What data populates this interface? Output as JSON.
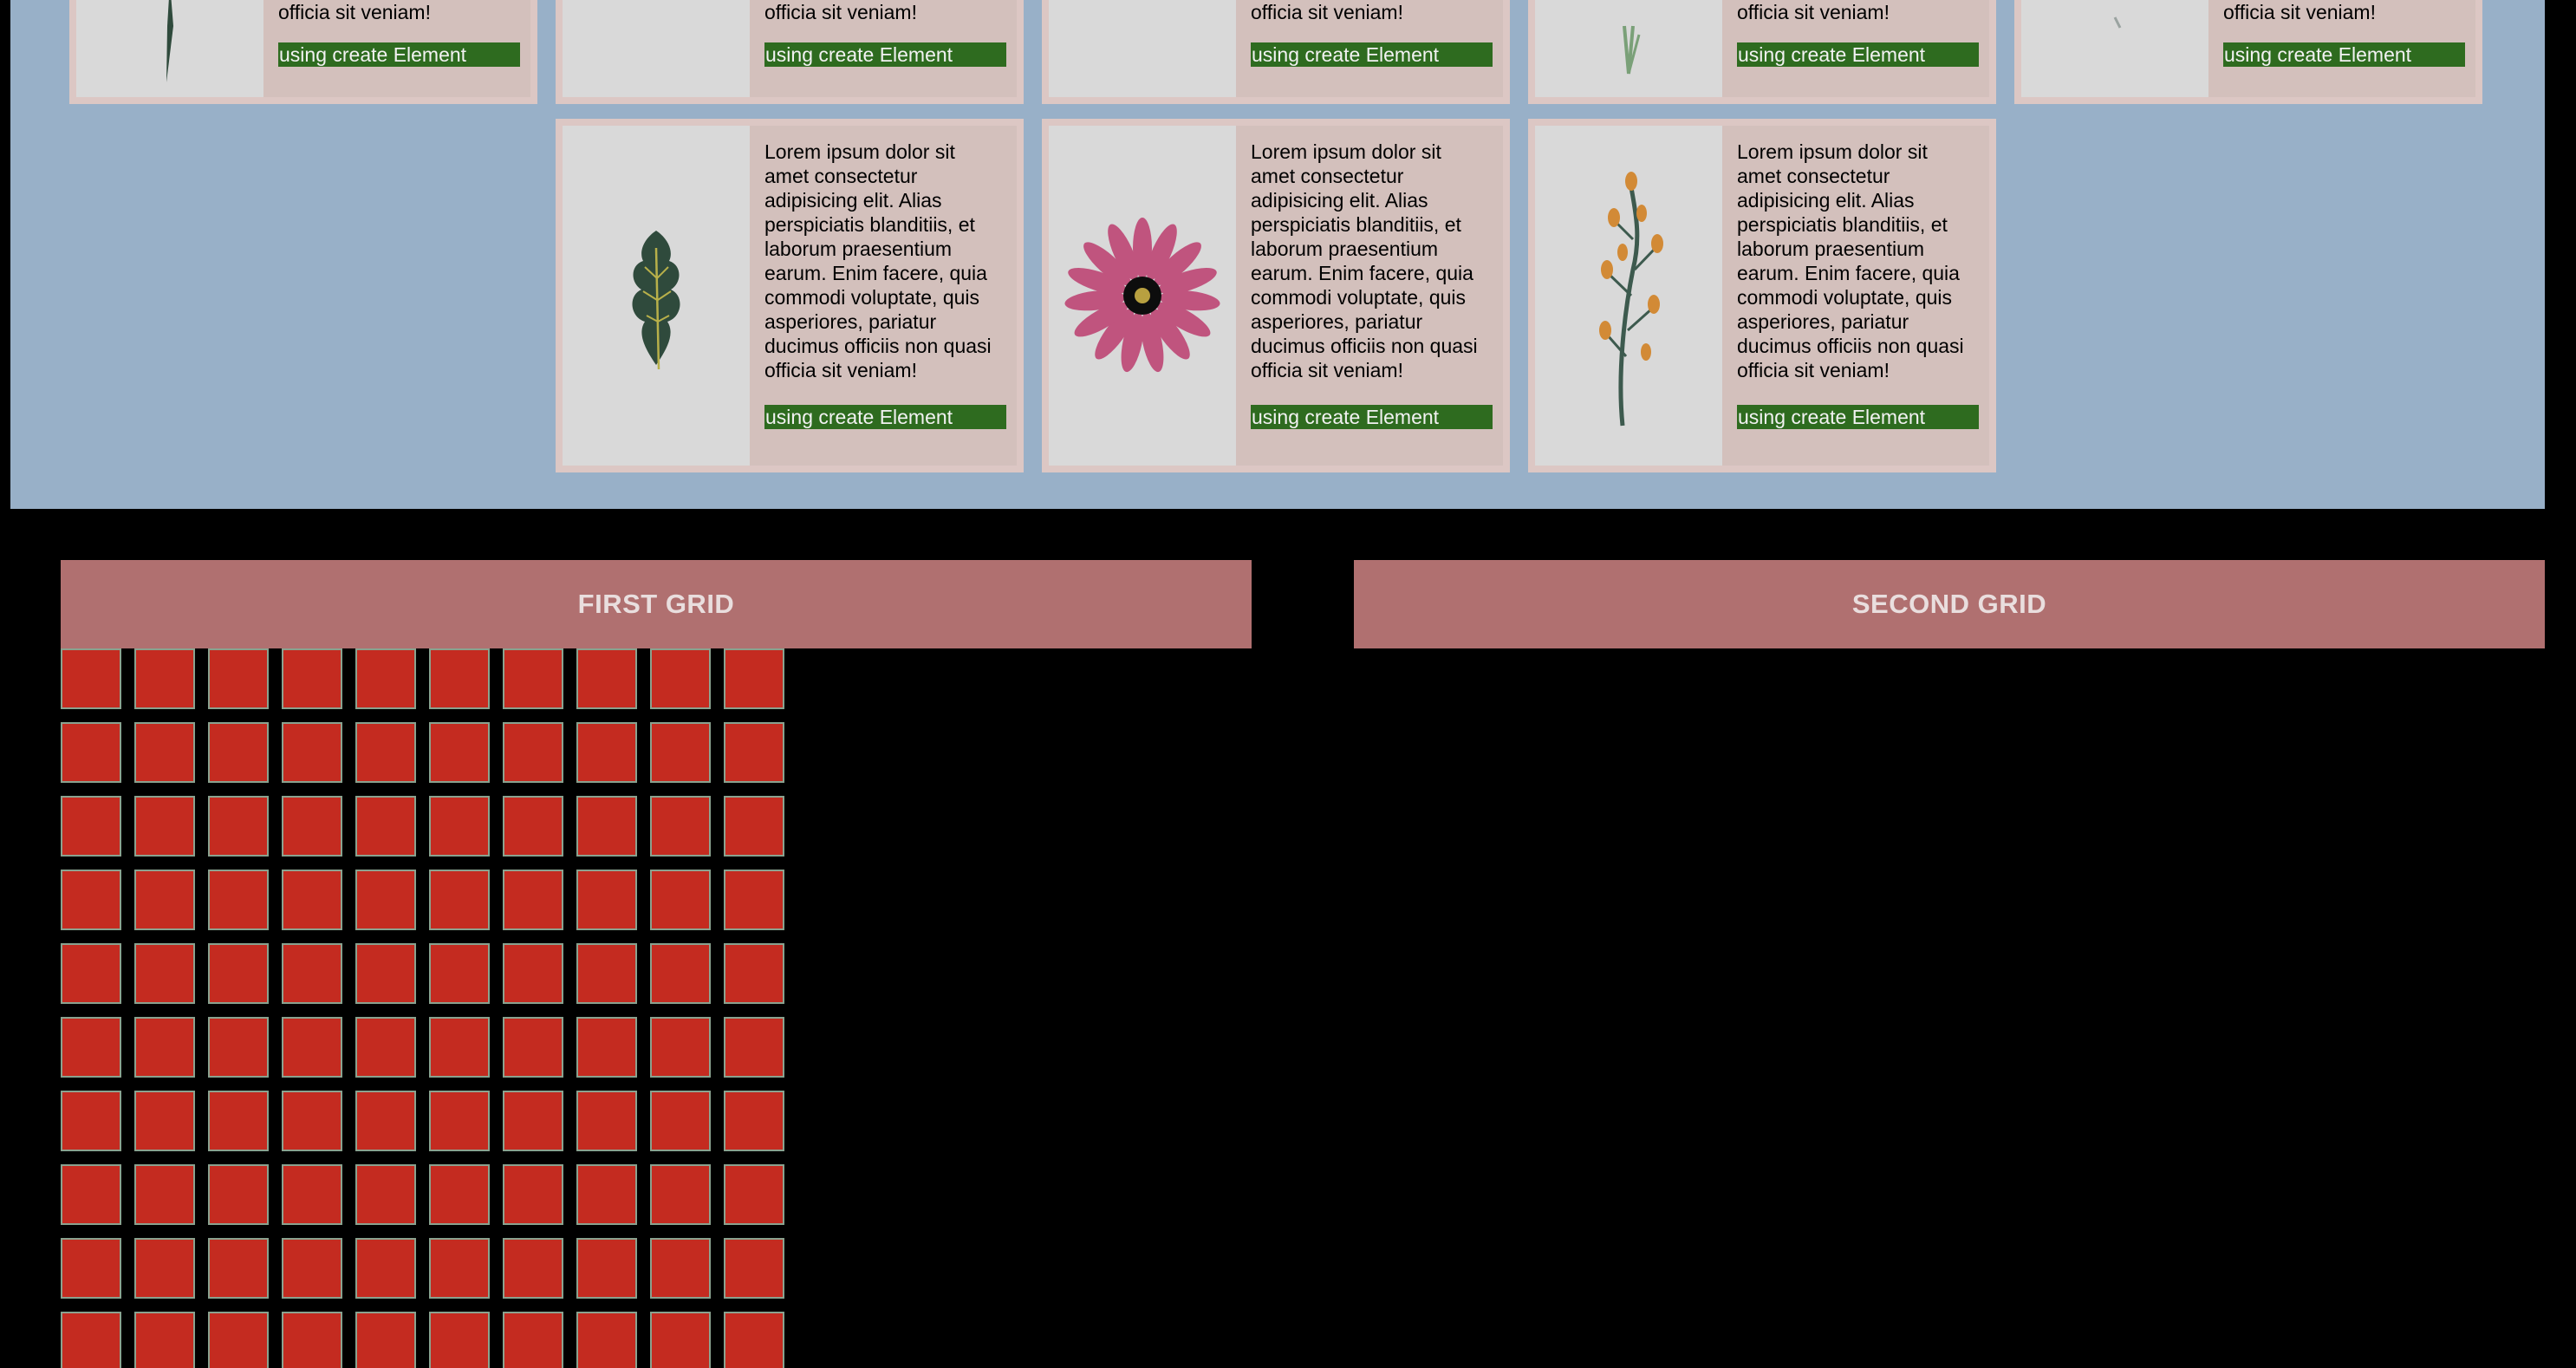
{
  "cards": {
    "description": "Lorem ipsum dolor sit amet consectetur adipisicing elit. Alias perspiciatis blanditiis, et laborum praesentium earum. Enim facere, quia commodi voluptate, quis asperiores, pariatur ducimus officiis non quasi officia sit veniam!",
    "description_tail": "officia sit veniam!",
    "button_label": "using create Element",
    "top_row": [
      {
        "icon": "grass-blade-icon"
      },
      {
        "icon": "blank-image"
      },
      {
        "icon": "blank-image"
      },
      {
        "icon": "green-sprig-icon"
      },
      {
        "icon": "branch-icon"
      }
    ],
    "bottom_row": [
      {
        "icon": "leaf-icon"
      },
      {
        "icon": "pink-flower-icon"
      },
      {
        "icon": "orange-berry-branch-icon"
      }
    ]
  },
  "grids": {
    "first": {
      "title": "FIRST GRID",
      "rows": 10,
      "cols": 10
    },
    "second": {
      "title": "SECOND GRID"
    }
  },
  "colors": {
    "panel_background": "#98b0c8",
    "card_border": "#dcc7c4",
    "card_body": "#d3c0bc",
    "button": "#2e6b1f",
    "grid_header": "#b07070",
    "grid_square": "#c42b20",
    "page_background": "#000000"
  }
}
